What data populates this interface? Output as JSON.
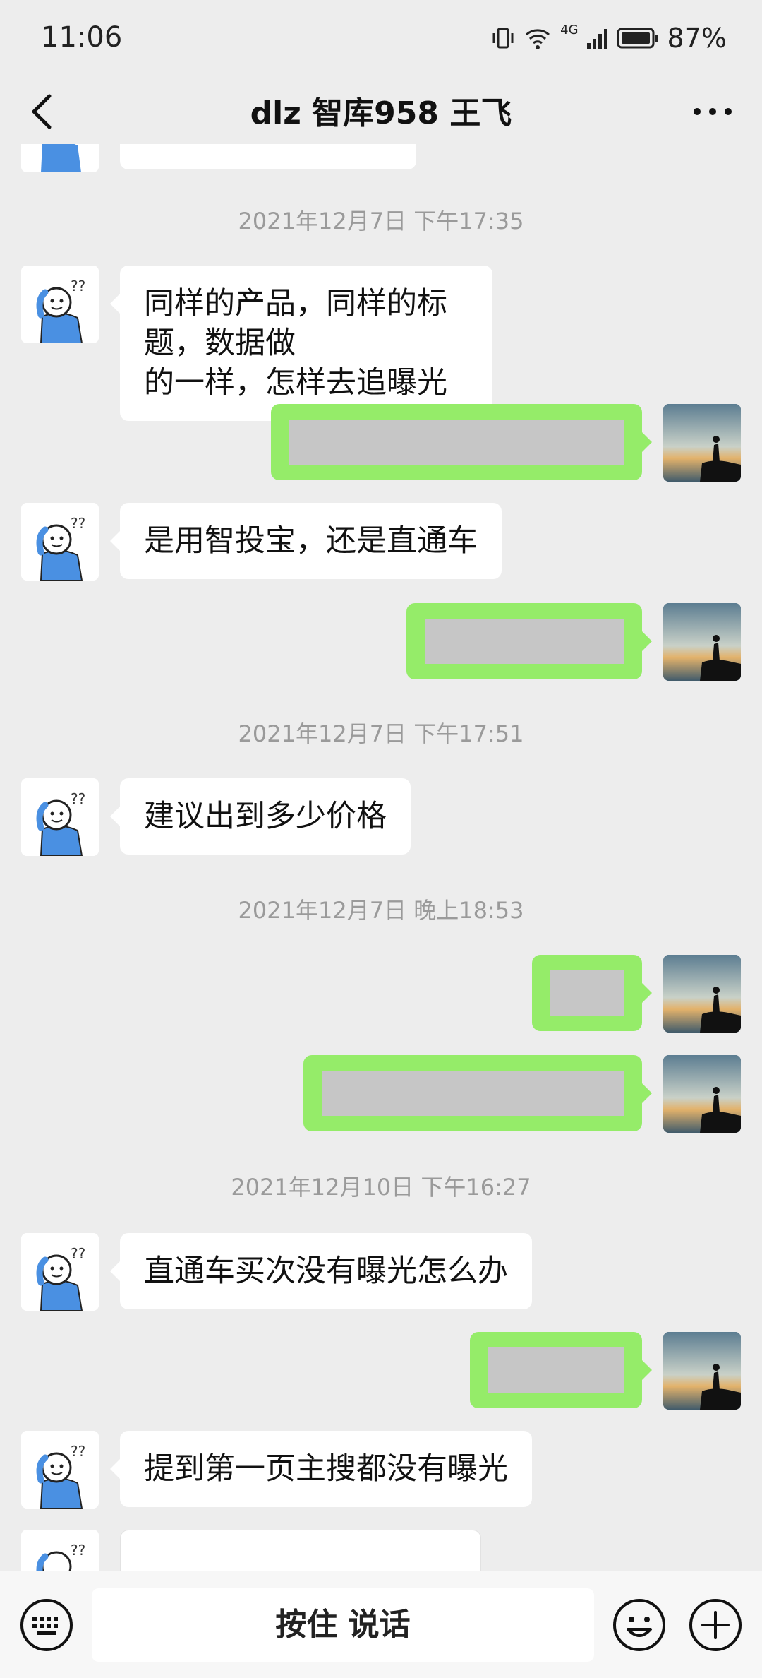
{
  "status": {
    "time": "11:06",
    "network": "4G",
    "battery": "87%"
  },
  "header": {
    "title": "dlz 智库958 王飞"
  },
  "messages": {
    "ts1": "2021年12月7日 下午17:35",
    "m1_line1": "同样的产品，同样的标题，数据做",
    "m1_line2": "的一样，怎样去追曝光",
    "m2": "是用智投宝，还是直通车",
    "ts2": "2021年12月7日 下午17:51",
    "m3": "建议出到多少价格",
    "ts3": "2021年12月7日 晚上18:53",
    "ts4": "2021年12月10日 下午16:27",
    "m4": "直通车买次没有曝光怎么办",
    "m5": "提到第一页主搜都没有曝光"
  },
  "bottom": {
    "voice_label": "按住 说话"
  },
  "colors": {
    "background": "#ededed",
    "sent_bubble": "#95ec69",
    "received_bubble": "#ffffff",
    "redaction": "#c6c6c6"
  },
  "icons": [
    "back-arrow-icon",
    "more-icon",
    "keyboard-icon",
    "emoji-icon",
    "plus-icon"
  ]
}
